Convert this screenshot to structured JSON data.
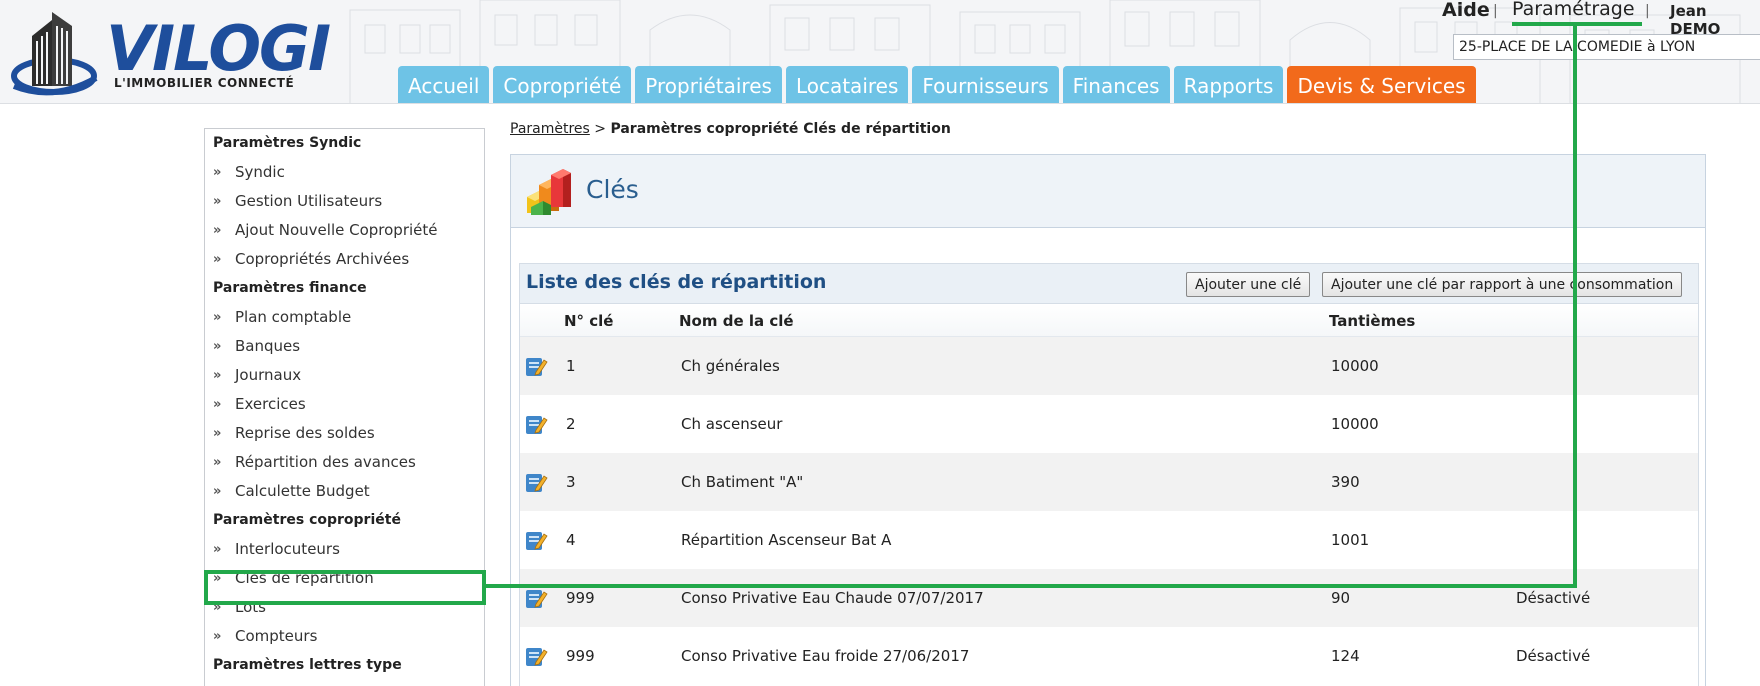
{
  "header": {
    "logo_text": "VILOGI",
    "logo_tagline": "L'IMMOBILIER CONNECTÉ",
    "aide": "Aide",
    "separator": "|",
    "parametrage": "Paramétrage",
    "user": "Jean DEMO",
    "address_value": "25-PLACE DE LA COMEDIE à LYON"
  },
  "nav": {
    "tabs": [
      {
        "label": "Accueil"
      },
      {
        "label": "Copropriété"
      },
      {
        "label": "Propriétaires"
      },
      {
        "label": "Locataires"
      },
      {
        "label": "Fournisseurs"
      },
      {
        "label": "Finances"
      },
      {
        "label": "Rapports"
      },
      {
        "label": "Devis & Services"
      }
    ]
  },
  "sidebar": {
    "sections": [
      {
        "title": "Paramètres Syndic",
        "items": [
          "Syndic",
          "Gestion Utilisateurs",
          "Ajout Nouvelle Copropriété",
          "Copropriétés Archivées"
        ]
      },
      {
        "title": "Paramètres finance",
        "items": [
          "Plan comptable",
          "Banques",
          "Journaux",
          "Exercices",
          "Reprise des soldes",
          "Répartition des avances",
          "Calculette Budget"
        ]
      },
      {
        "title": "Paramètres copropriété",
        "items": [
          "Interlocuteurs",
          "Clés de répartition",
          "Lots",
          "Compteurs"
        ]
      },
      {
        "title": "Paramètres lettres type",
        "items": []
      }
    ]
  },
  "breadcrumb": {
    "link": "Paramètres",
    "separator": ">",
    "current": "Paramètres copropriété Clés de répartition"
  },
  "panel": {
    "title": "Clés"
  },
  "list": {
    "title": "Liste des clés de répartition",
    "btn_add": "Ajouter une clé",
    "btn_add_conso": "Ajouter une clé par rapport à une consommation",
    "columns": {
      "num": "N° clé",
      "name": "Nom de la clé",
      "tantiemes": "Tantièmes"
    },
    "rows": [
      {
        "num": "1",
        "name": "Ch générales",
        "tantiemes": "10000",
        "status": ""
      },
      {
        "num": "2",
        "name": "Ch ascenseur",
        "tantiemes": "10000",
        "status": ""
      },
      {
        "num": "3",
        "name": "Ch Batiment \"A\"",
        "tantiemes": "390",
        "status": ""
      },
      {
        "num": "4",
        "name": "Répartition Ascenseur Bat A",
        "tantiemes": "1001",
        "status": ""
      },
      {
        "num": "999",
        "name": "Conso Privative Eau Chaude 07/07/2017",
        "tantiemes": "90",
        "status": "Désactivé"
      },
      {
        "num": "999",
        "name": "Conso Privative Eau froide 27/06/2017",
        "tantiemes": "124",
        "status": "Désactivé"
      }
    ]
  },
  "colors": {
    "nav_blue": "#6ec3e6",
    "nav_orange": "#f26a1b",
    "annotation_green": "#22a84a",
    "title_blue": "#1f4f84"
  }
}
